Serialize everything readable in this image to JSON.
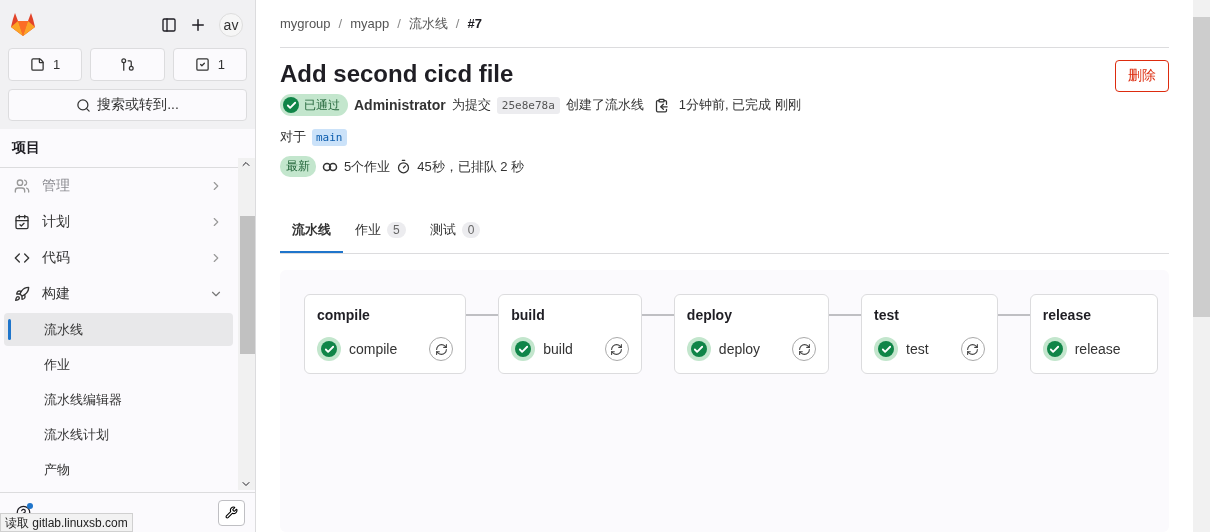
{
  "sidebar": {
    "counters": [
      {
        "kind": "issues",
        "count": "1"
      },
      {
        "kind": "merge"
      },
      {
        "kind": "todo",
        "count": "1"
      }
    ],
    "avatar": "av",
    "search": {
      "placeholder": "搜索或转到..."
    },
    "section_title": "项目",
    "items": [
      {
        "kind": "manage",
        "label": "管理",
        "expanded": false,
        "dim": true
      },
      {
        "kind": "plan",
        "label": "计划",
        "expanded": false,
        "dim": false
      },
      {
        "kind": "code",
        "label": "代码",
        "expanded": false,
        "dim": false
      },
      {
        "kind": "build",
        "label": "构建",
        "expanded": true,
        "dim": false,
        "children": [
          {
            "label": "流水线",
            "selected": true
          },
          {
            "label": "作业",
            "selected": false
          },
          {
            "label": "流水线编辑器",
            "selected": false
          },
          {
            "label": "流水线计划",
            "selected": false
          },
          {
            "label": "产物",
            "selected": false
          }
        ]
      }
    ],
    "help_dot": true
  },
  "breadcrumbs": [
    "mygroup",
    "myapp",
    "流水线",
    "#7"
  ],
  "breadcrumb_separator": "/",
  "title": "Add second cicd file",
  "delete_button": "删除",
  "meta": {
    "status": "已通过",
    "author": "Administrator",
    "text1": "为提交",
    "commit": "25e8e78a",
    "text2": "创建了流水线",
    "time": "1分钟前, 已完成 刚刚",
    "for": "对于",
    "branch": "main",
    "latest": "最新",
    "jobs": "5个作业",
    "duration": "45秒，已排队 2 秒"
  },
  "tabs": [
    {
      "label": "流水线",
      "selected": true
    },
    {
      "label": "作业",
      "count": "5",
      "selected": false
    },
    {
      "label": "测试",
      "count": "0",
      "selected": false
    }
  ],
  "stages": [
    {
      "name": "compile",
      "job": "compile",
      "passed": true,
      "retry": true
    },
    {
      "name": "build",
      "job": "build",
      "passed": true,
      "retry": true
    },
    {
      "name": "deploy",
      "job": "deploy",
      "passed": true,
      "retry": true
    },
    {
      "name": "test",
      "job": "test",
      "passed": true,
      "retry": true
    },
    {
      "name": "release",
      "job": "release",
      "passed": true,
      "retry": false
    }
  ],
  "status_bar": "读取 gitlab.linuxsb.com"
}
